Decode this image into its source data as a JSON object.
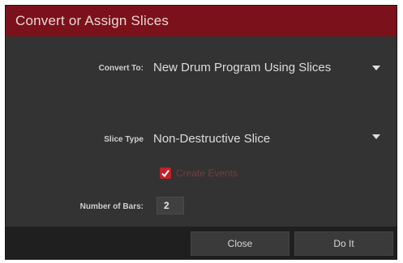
{
  "dialog": {
    "title": "Convert or Assign Slices",
    "convert_to": {
      "label": "Convert To:",
      "value": "New Drum Program Using Slices"
    },
    "slice_type": {
      "label": "Slice Type",
      "value": "Non-Destructive Slice"
    },
    "create_events": {
      "label": "Create Events",
      "checked": true
    },
    "number_of_bars": {
      "label": "Number of Bars:",
      "value": "2"
    },
    "buttons": {
      "close": "Close",
      "do_it": "Do It"
    }
  },
  "colors": {
    "title_bar": "#7b111a",
    "body_bg": "#333333",
    "footer_bg": "#1f1f1f",
    "checkbox_accent": "#c4202a"
  },
  "icons": [
    "dropdown-arrow-icon",
    "checkmark-icon"
  ]
}
